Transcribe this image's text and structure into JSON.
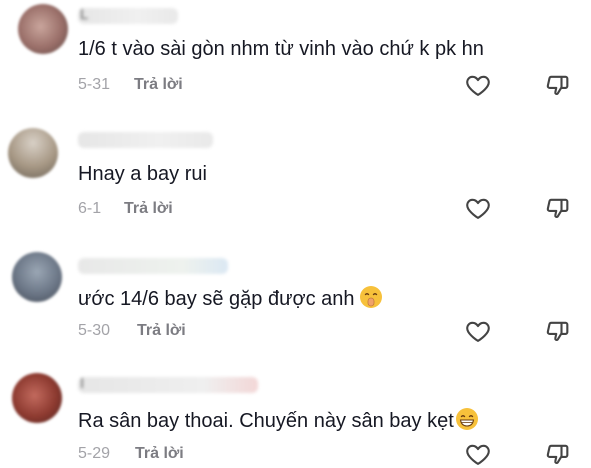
{
  "comments": [
    {
      "username_initial": "L",
      "text": "1/6 t vào sài gòn nhm từ vinh vào chứ k pk hn",
      "date": "5-31",
      "reply_label": "Trả lời",
      "emoji": ""
    },
    {
      "username_initial": "",
      "text": "Hnay a bay rui",
      "date": "6-1",
      "reply_label": "Trả lời",
      "emoji": ""
    },
    {
      "username_initial": "",
      "text": "ước 14/6 bay sẽ gặp được anh",
      "date": "5-30",
      "reply_label": "Trả lời",
      "emoji": "shushing-face-emoji"
    },
    {
      "username_initial": "I",
      "text": "Ra sân bay thoai. Chuyến này sân bay kẹt",
      "date": "5-29",
      "reply_label": "Trả lời",
      "emoji": "grinning-face-emoji"
    }
  ],
  "icons": {
    "like": "heart-outline-icon",
    "dislike": "thumbs-down-outline-icon"
  },
  "colors": {
    "text": "#161823",
    "date": "#a3a3a8",
    "reply": "#7c7c82",
    "icon": "#444444"
  }
}
